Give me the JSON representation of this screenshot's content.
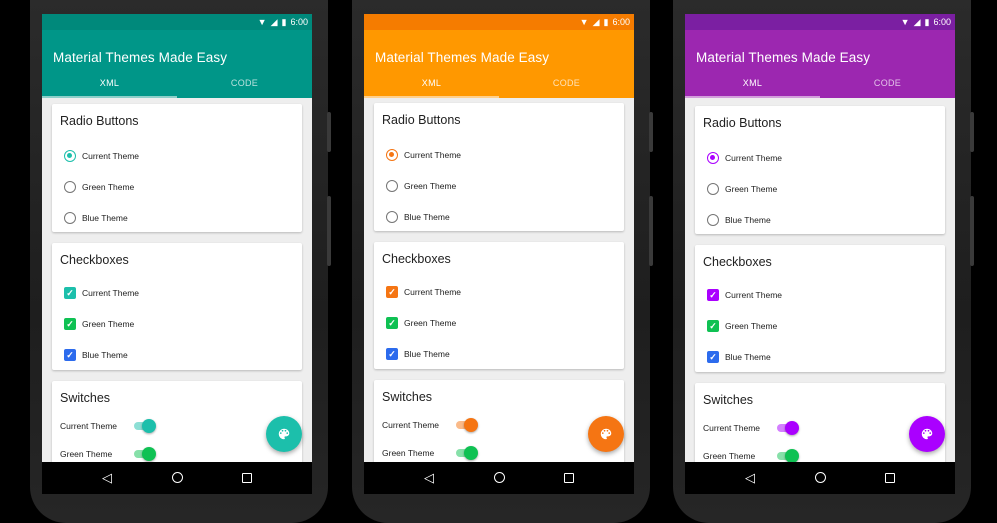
{
  "status_bar": {
    "time": "6:00"
  },
  "app": {
    "title": "Material Themes Made Easy"
  },
  "tabs": [
    {
      "label": "XML"
    },
    {
      "label": "CODE"
    }
  ],
  "sections": {
    "radio": {
      "title": "Radio Buttons",
      "items": [
        "Current Theme",
        "Green Theme",
        "Blue Theme"
      ],
      "selected": 0
    },
    "checkbox": {
      "title": "Checkboxes",
      "items": [
        "Current Theme",
        "Green Theme",
        "Blue Theme"
      ],
      "checked": [
        true,
        true,
        true
      ]
    },
    "switches": {
      "title": "Switches",
      "items": [
        "Current Theme",
        "Green Theme"
      ],
      "on": [
        true,
        true
      ]
    }
  },
  "themes": [
    {
      "name": "teal",
      "status_color": "#00897b",
      "primary": "#009688",
      "accent": "#1cbfab"
    },
    {
      "name": "orange",
      "status_color": "#f57c00",
      "primary": "#ff9800",
      "accent": "#f57513"
    },
    {
      "name": "purple",
      "status_color": "#7b1fa2",
      "primary": "#9c27b0",
      "accent": "#aa00ff"
    }
  ],
  "fixed_colors": {
    "green": "#0fc153",
    "blue": "#2c6bed"
  },
  "icons": {
    "fab": "palette-icon",
    "nav": [
      "back-icon",
      "home-icon",
      "recents-icon"
    ],
    "status": [
      "wifi-icon",
      "signal-icon",
      "battery-icon"
    ]
  }
}
